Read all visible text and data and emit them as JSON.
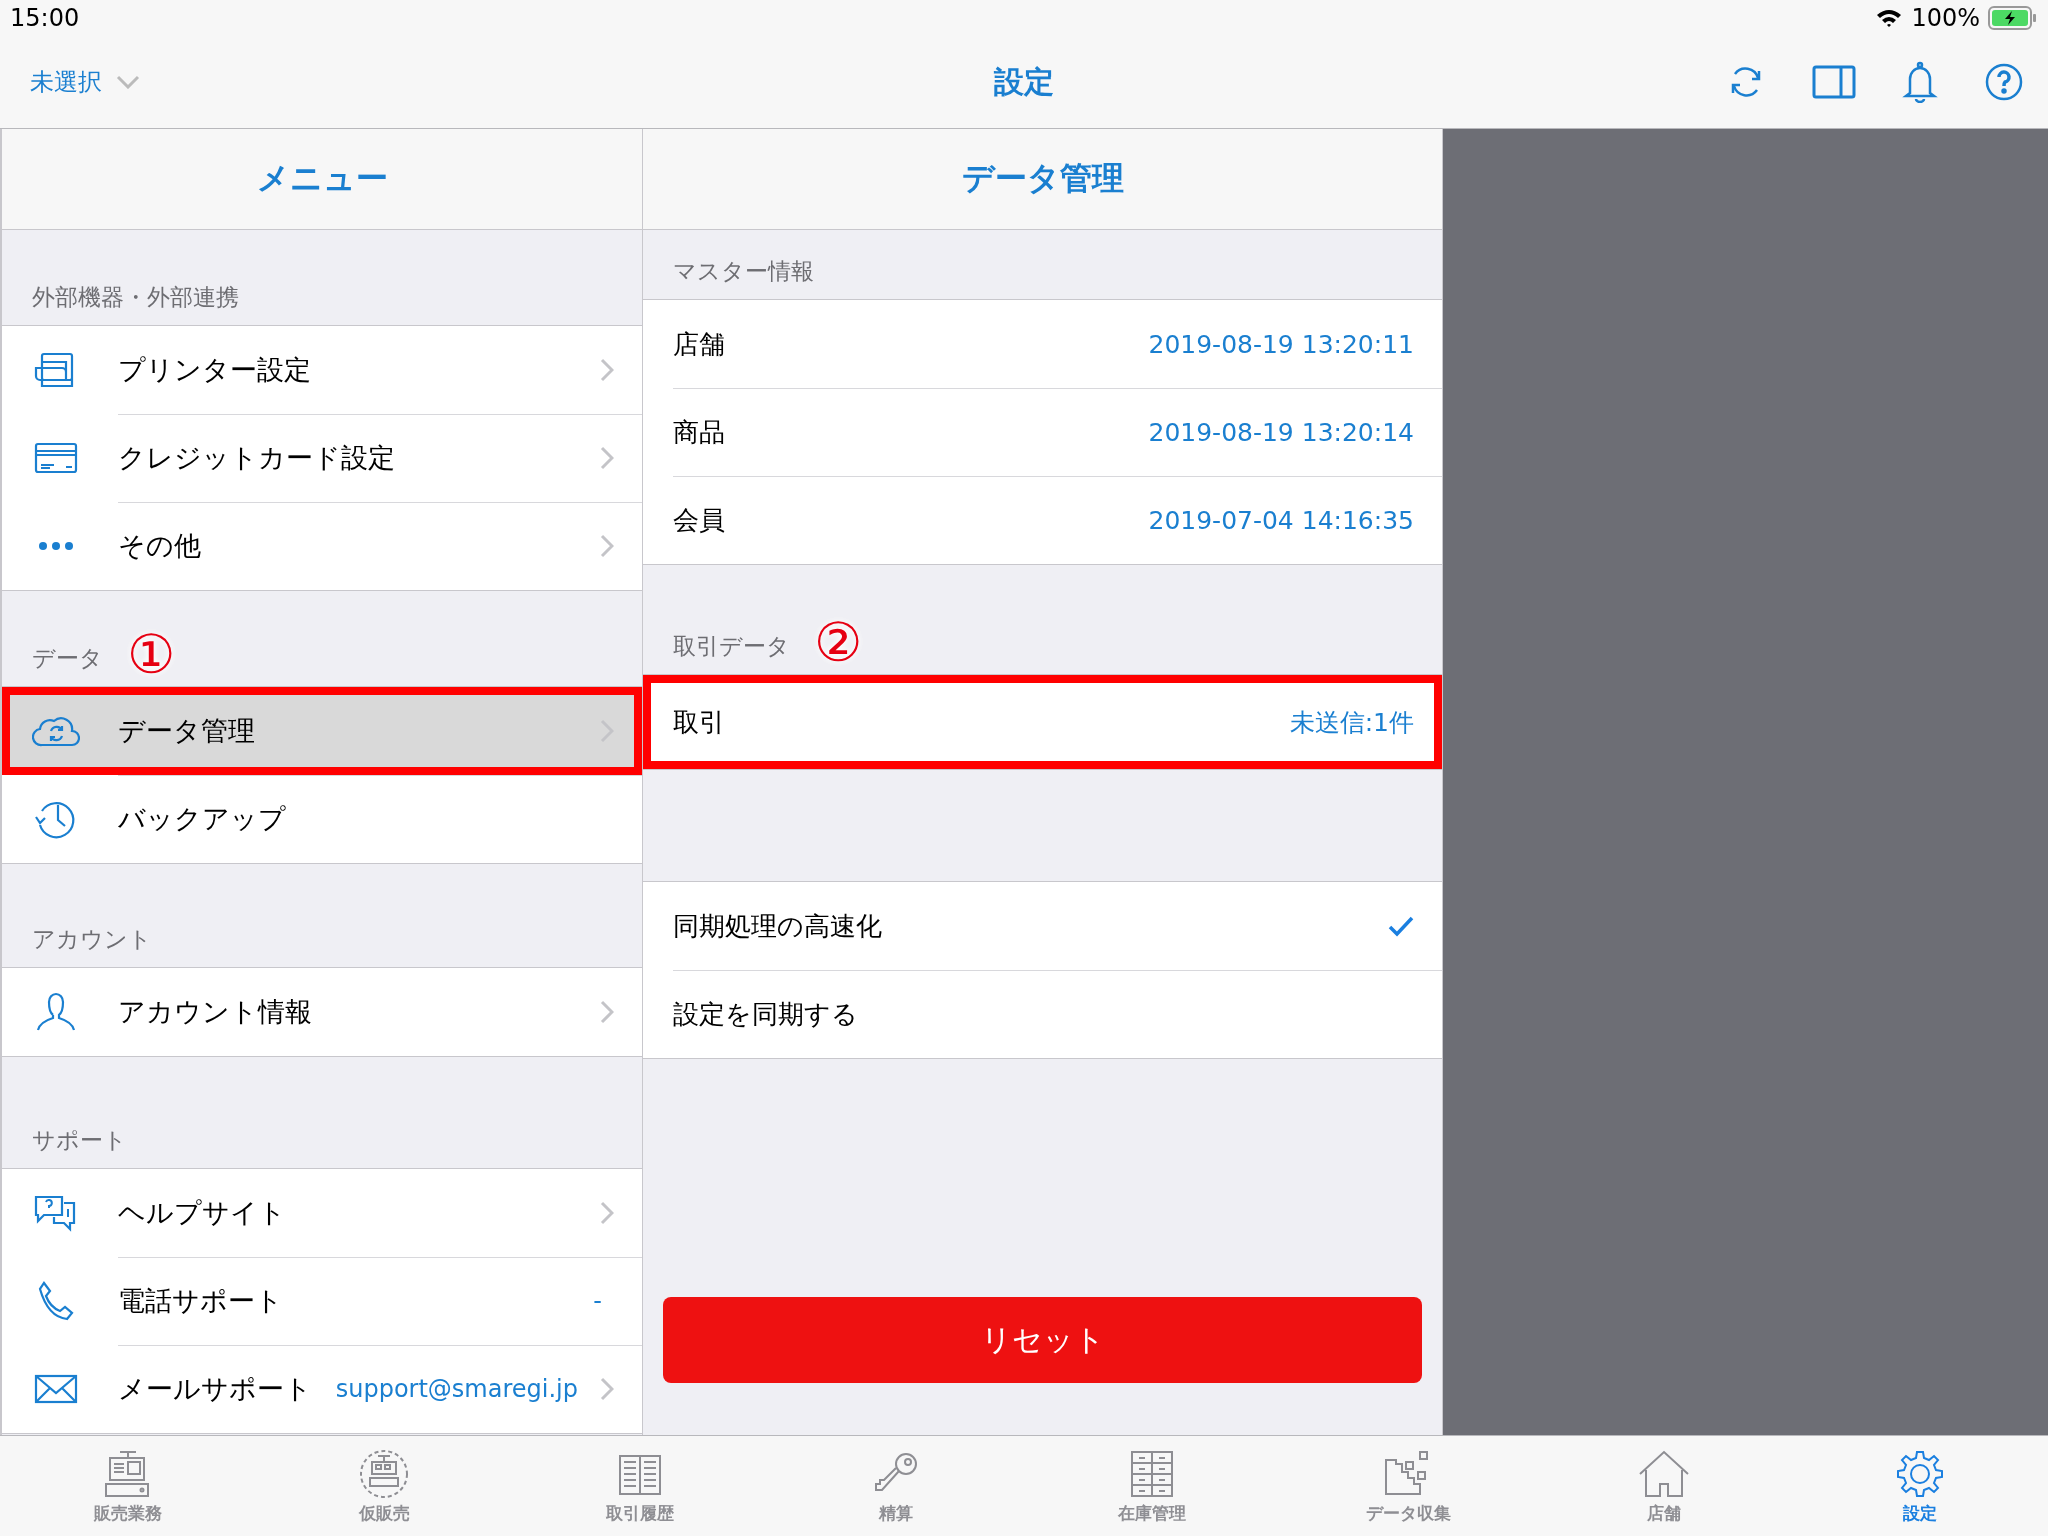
{
  "status_bar": {
    "time": "15:00",
    "battery": "100%"
  },
  "nav_bar": {
    "store_picker": "未選択",
    "title": "設定"
  },
  "menu": {
    "title": "メニュー",
    "sections": [
      {
        "header": "外部機器・外部連携",
        "items": [
          {
            "kind": "printer",
            "label": "プリンター設定",
            "chevron": true,
            "selected": false,
            "highlighted": false
          },
          {
            "kind": "card",
            "label": "クレジットカード設定",
            "chevron": true,
            "selected": false,
            "highlighted": false
          },
          {
            "kind": "dots",
            "label": "その他",
            "chevron": true,
            "selected": false,
            "highlighted": false
          }
        ]
      },
      {
        "header": "データ",
        "annotation": "①",
        "items": [
          {
            "kind": "cloud",
            "label": "データ管理",
            "chevron": true,
            "selected": true,
            "highlighted": true
          },
          {
            "kind": "history",
            "label": "バックアップ",
            "chevron": false,
            "selected": false,
            "highlighted": false
          }
        ]
      },
      {
        "header": "アカウント",
        "items": [
          {
            "kind": "person",
            "label": "アカウント情報",
            "chevron": true,
            "selected": false,
            "highlighted": false
          }
        ]
      },
      {
        "header": "サポート",
        "items": [
          {
            "kind": "help",
            "label": "ヘルプサイト",
            "chevron": true,
            "selected": false,
            "highlighted": false
          },
          {
            "kind": "phone",
            "label": "電話サポート",
            "value": "-",
            "chevron": false,
            "selected": false,
            "highlighted": false
          },
          {
            "kind": "mail",
            "label": "メールサポート",
            "value": "support@smaregi.jp",
            "chevron": true,
            "selected": false,
            "highlighted": false
          }
        ]
      }
    ]
  },
  "detail": {
    "title": "データ管理",
    "sections": [
      {
        "header": "マスター情報",
        "rows": [
          {
            "label": "店舗",
            "value": "2019-08-19 13:20:11",
            "highlighted": false
          },
          {
            "label": "商品",
            "value": "2019-08-19 13:20:14",
            "highlighted": false
          },
          {
            "label": "会員",
            "value": "2019-07-04 14:16:35",
            "highlighted": false
          }
        ]
      },
      {
        "header": "取引データ",
        "annotation": "②",
        "rows": [
          {
            "label": "取引",
            "value": "未送信:1件",
            "highlighted": true
          }
        ]
      },
      {
        "rows": [
          {
            "label": "同期処理の高速化",
            "checked": true,
            "highlighted": false
          },
          {
            "label": "設定を同期する",
            "checked": false,
            "highlighted": false
          }
        ]
      }
    ],
    "reset_button": "リセット"
  },
  "tabs": [
    {
      "kind": "register",
      "label": "販売業務",
      "selected": false
    },
    {
      "kind": "temp",
      "label": "仮販売",
      "selected": false
    },
    {
      "kind": "ledger",
      "label": "取引履歴",
      "selected": false
    },
    {
      "kind": "key",
      "label": "精算",
      "selected": false
    },
    {
      "kind": "cabinet",
      "label": "在庫管理",
      "selected": false
    },
    {
      "kind": "blocks",
      "label": "データ収集",
      "selected": false
    },
    {
      "kind": "house",
      "label": "店舗",
      "selected": false
    },
    {
      "kind": "gear",
      "label": "設定",
      "selected": true
    }
  ]
}
